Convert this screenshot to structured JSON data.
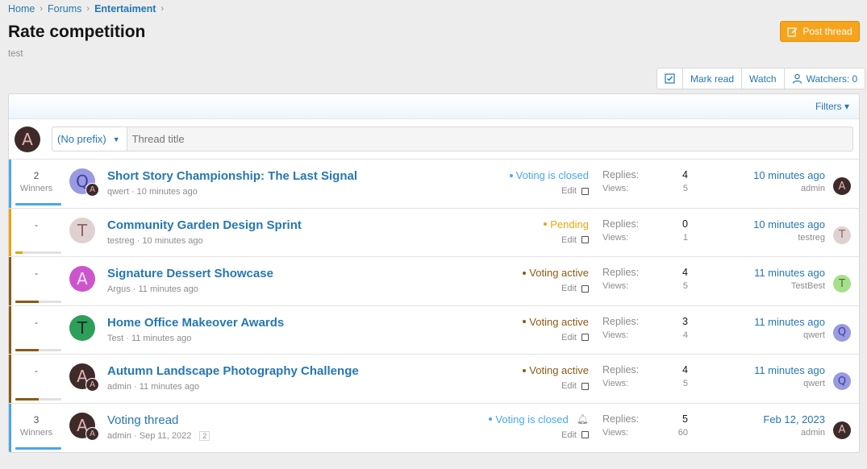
{
  "breadcrumb": {
    "home": "Home",
    "forums": "Forums",
    "current": "Entertaiment"
  },
  "page": {
    "title": "Rate competition",
    "description": "test"
  },
  "post_button": {
    "label": "Post thread",
    "icon": "edit-icon"
  },
  "actions": {
    "mark_read": "Mark read",
    "watch": "Watch",
    "watchers": "Watchers: 0"
  },
  "filters": {
    "label": "Filters"
  },
  "quick_thread": {
    "avatar_letter": "A",
    "prefix": "(No prefix)",
    "placeholder": "Thread title"
  },
  "colors": {
    "accent": "#2577b1",
    "button_orange": "#f7a41d",
    "status_closed": "#47a7eb",
    "status_pending": "#e8a50c",
    "status_active": "#8b5a14"
  },
  "threads": [
    {
      "count": "2",
      "count_label": "Winners",
      "count_fill": 1.0,
      "stripe": "#47a7eb",
      "avatar_letter": "Q",
      "avatar_bg": "#9a9ae0",
      "avatar_fg": "#3d3da3",
      "sub_avatar_letter": "A",
      "title": "Short Story Championship: The Last Signal",
      "bold": true,
      "author": "qwert",
      "time": "10 minutes ago",
      "pages": "",
      "status": "Voting is closed",
      "status_color": "#47a7eb",
      "bell": false,
      "edit": "Edit",
      "replies_label": "Replies:",
      "replies": "4",
      "views_label": "Views:",
      "views": "5",
      "last_time": "10 minutes ago",
      "last_user": "admin",
      "last_letter": "A",
      "last_bg": "#3f2a2a",
      "last_fg": "#e0b4b4"
    },
    {
      "count": "-",
      "count_label": "",
      "count_fill": 0.15,
      "stripe": "#e8a50c",
      "avatar_letter": "T",
      "avatar_bg": "#e0d1d1",
      "avatar_fg": "#8f6262",
      "sub_avatar_letter": "",
      "title": "Community Garden Design Sprint",
      "bold": true,
      "author": "testreg",
      "time": "10 minutes ago",
      "pages": "",
      "status": "Pending",
      "status_color": "#e8a50c",
      "bell": false,
      "edit": "Edit",
      "replies_label": "Replies:",
      "replies": "0",
      "views_label": "Views:",
      "views": "1",
      "last_time": "10 minutes ago",
      "last_user": "testreg",
      "last_letter": "T",
      "last_bg": "#e0d1d1",
      "last_fg": "#8f6262"
    },
    {
      "count": "-",
      "count_label": "",
      "count_fill": 0.5,
      "stripe": "#8b5a14",
      "avatar_letter": "A",
      "avatar_bg": "#cc55cc",
      "avatar_fg": "#f5dff5",
      "sub_avatar_letter": "",
      "title": "Signature Dessert Showcase",
      "bold": true,
      "author": "Argus",
      "time": "11 minutes ago",
      "pages": "",
      "status": "Voting active",
      "status_color": "#8b5a14",
      "bell": false,
      "edit": "Edit",
      "replies_label": "Replies:",
      "replies": "4",
      "views_label": "Views:",
      "views": "5",
      "last_time": "11 minutes ago",
      "last_user": "TestBest",
      "last_letter": "T",
      "last_bg": "#a6e08c",
      "last_fg": "#3f7a24"
    },
    {
      "count": "-",
      "count_label": "",
      "count_fill": 0.5,
      "stripe": "#8b5a14",
      "avatar_letter": "T",
      "avatar_bg": "#2e9e5b",
      "avatar_fg": "#0e2e1a",
      "sub_avatar_letter": "",
      "title": "Home Office Makeover Awards",
      "bold": true,
      "author": "Test",
      "time": "11 minutes ago",
      "pages": "",
      "status": "Voting active",
      "status_color": "#8b5a14",
      "bell": false,
      "edit": "Edit",
      "replies_label": "Replies:",
      "replies": "3",
      "views_label": "Views:",
      "views": "4",
      "last_time": "11 minutes ago",
      "last_user": "qwert",
      "last_letter": "Q",
      "last_bg": "#9a9ae0",
      "last_fg": "#3d3da3"
    },
    {
      "count": "-",
      "count_label": "",
      "count_fill": 0.5,
      "stripe": "#8b5a14",
      "avatar_letter": "A",
      "avatar_bg": "#3f2a2a",
      "avatar_fg": "#e0b4b4",
      "sub_avatar_letter": "A",
      "title": "Autumn Landscape Photography Challenge",
      "bold": true,
      "author": "admin",
      "time": "11 minutes ago",
      "pages": "",
      "status": "Voting active",
      "status_color": "#8b5a14",
      "bell": false,
      "edit": "Edit",
      "replies_label": "Replies:",
      "replies": "4",
      "views_label": "Views:",
      "views": "5",
      "last_time": "11 minutes ago",
      "last_user": "qwert",
      "last_letter": "Q",
      "last_bg": "#9a9ae0",
      "last_fg": "#3d3da3"
    },
    {
      "count": "3",
      "count_label": "Winners",
      "count_fill": 1.0,
      "stripe": "#47a7eb",
      "avatar_letter": "A",
      "avatar_bg": "#3f2a2a",
      "avatar_fg": "#e0b4b4",
      "sub_avatar_letter": "A",
      "title": "Voting thread",
      "bold": false,
      "author": "admin",
      "time": "Sep 11, 2022",
      "pages": "2",
      "status": "Voting is closed",
      "status_color": "#47a7eb",
      "bell": true,
      "edit": "Edit",
      "replies_label": "Replies:",
      "replies": "5",
      "views_label": "Views:",
      "views": "60",
      "last_time": "Feb 12, 2023",
      "last_user": "admin",
      "last_letter": "A",
      "last_bg": "#3f2a2a",
      "last_fg": "#e0b4b4"
    }
  ]
}
